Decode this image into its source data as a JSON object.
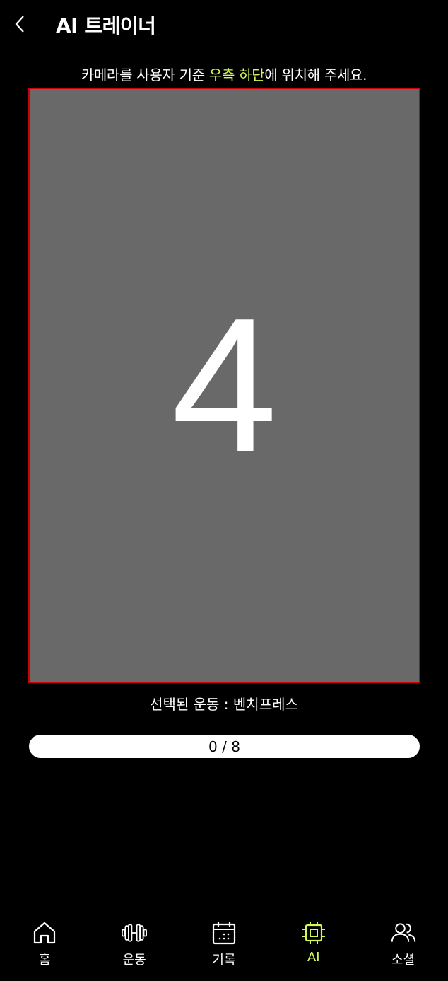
{
  "header": {
    "title": "AI 트레이너",
    "back_icon": "chevron-left-icon"
  },
  "instruction": {
    "before": "카메라를 사용자 기준 ",
    "highlight": "우측 하단",
    "after": "에 위치해 주세요.",
    "highlight_color": "#d4f85a"
  },
  "camera": {
    "countdown": "4",
    "background_color": "#696969",
    "border_color": "#d00000"
  },
  "exercise": {
    "label": "선택된 운동 : 벤치프레스"
  },
  "progress": {
    "text": "0 / 8",
    "current": 0,
    "total": 8,
    "fraction": 0
  },
  "nav": {
    "items": [
      {
        "label": "홈",
        "icon": "home-icon",
        "active": false
      },
      {
        "label": "운동",
        "icon": "dumbbell-icon",
        "active": false
      },
      {
        "label": "기록",
        "icon": "calendar-icon",
        "active": false
      },
      {
        "label": "AI",
        "icon": "chip-icon",
        "active": true
      },
      {
        "label": "소셜",
        "icon": "users-icon",
        "active": false
      }
    ],
    "active_color": "#d4f85a"
  }
}
